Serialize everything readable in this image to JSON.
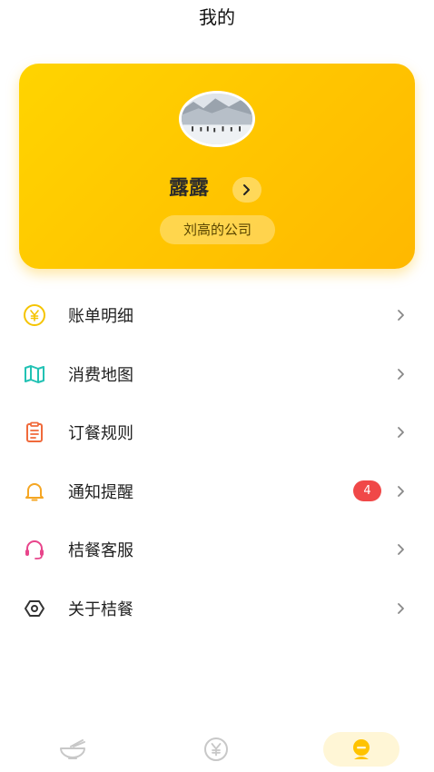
{
  "header": {
    "title": "我的"
  },
  "profile": {
    "name": "露露",
    "company": "刘高的公司"
  },
  "menu": {
    "items": [
      {
        "label": "账单明细",
        "icon": "yen-circle-icon",
        "color": "#f5c400"
      },
      {
        "label": "消费地图",
        "icon": "map-icon",
        "color": "#22c2b4"
      },
      {
        "label": "订餐规则",
        "icon": "clipboard-icon",
        "color": "#f06a3b"
      },
      {
        "label": "通知提醒",
        "icon": "bell-icon",
        "color": "#f5a623",
        "badge": "4"
      },
      {
        "label": "桔餐客服",
        "icon": "headset-icon",
        "color": "#e8458b"
      },
      {
        "label": "关于桔餐",
        "icon": "hexagon-icon",
        "color": "#333333"
      }
    ]
  },
  "tabbar": {
    "tabs": [
      {
        "icon": "bowl-icon",
        "active": false
      },
      {
        "icon": "yen-circle-icon",
        "active": false
      },
      {
        "icon": "profile-icon",
        "active": true
      }
    ],
    "accent": "#ffc300"
  }
}
